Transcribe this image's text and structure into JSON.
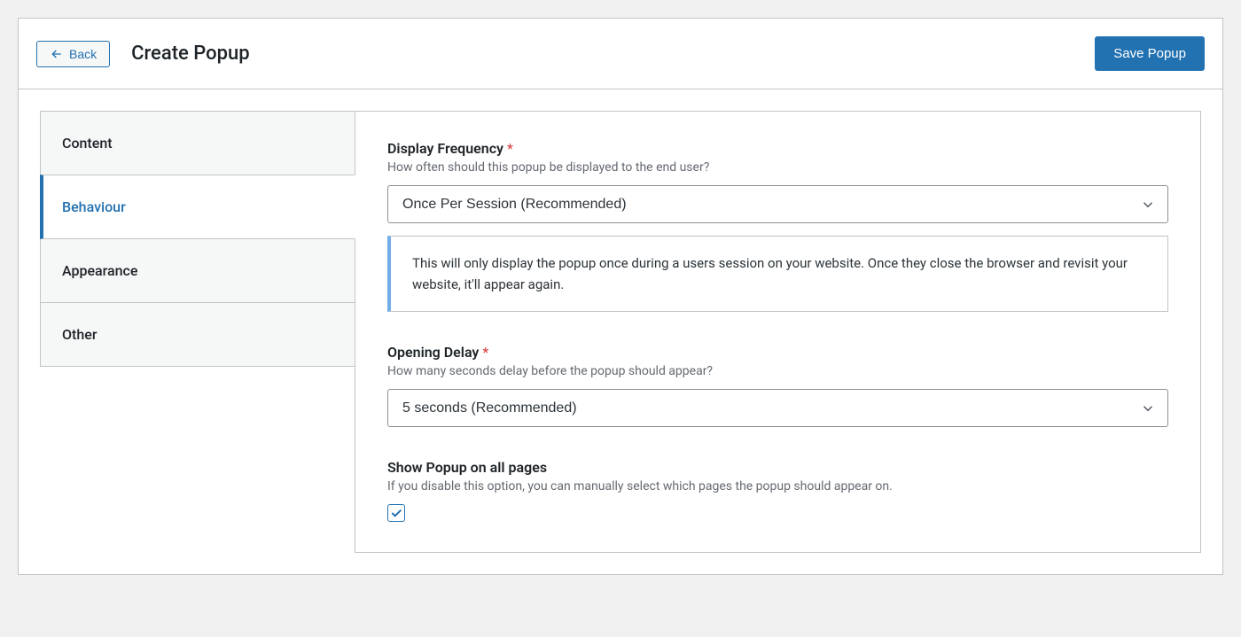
{
  "header": {
    "back_label": "Back",
    "title": "Create Popup",
    "save_label": "Save Popup"
  },
  "tabs": [
    {
      "label": "Content",
      "active": false
    },
    {
      "label": "Behaviour",
      "active": true
    },
    {
      "label": "Appearance",
      "active": false
    },
    {
      "label": "Other",
      "active": false
    }
  ],
  "fields": {
    "display_frequency": {
      "label": "Display Frequency",
      "required_mark": "*",
      "help": "How often should this popup be displayed to the end user?",
      "value": "Once Per Session (Recommended)",
      "notice": "This will only display the popup once during a users session on your website. Once they close the browser and revisit your website, it'll appear again."
    },
    "opening_delay": {
      "label": "Opening Delay",
      "required_mark": "*",
      "help": "How many seconds delay before the popup should appear?",
      "value": "5 seconds (Recommended)"
    },
    "show_all_pages": {
      "label": "Show Popup on all pages",
      "help": "If you disable this option, you can manually select which pages the popup should appear on.",
      "checked": true
    }
  }
}
